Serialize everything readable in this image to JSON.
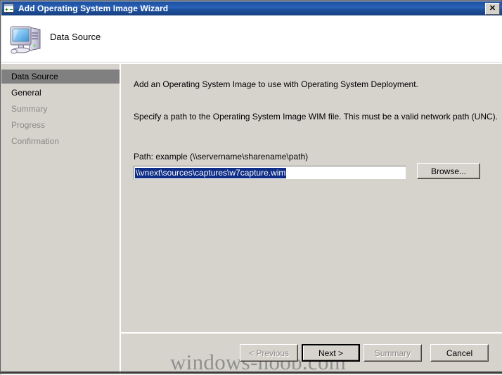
{
  "window": {
    "title": "Add Operating System Image Wizard",
    "icon": "wizard-window-icon",
    "close_label": "✕"
  },
  "header": {
    "icon": "computer-icon",
    "page_title": "Data Source"
  },
  "nav": {
    "items": [
      {
        "label": "Data Source",
        "state": "selected"
      },
      {
        "label": "General",
        "state": "enabled"
      },
      {
        "label": "Summary",
        "state": "disabled"
      },
      {
        "label": "Progress",
        "state": "disabled"
      },
      {
        "label": "Confirmation",
        "state": "disabled"
      }
    ]
  },
  "body": {
    "intro_text": "Add an Operating System Image to use with Operating System Deployment.",
    "instruction_text": "Specify a path to the Operating System Image WIM file. This must be a valid network path (UNC).",
    "path_label": "Path: example (\\\\servername\\sharename\\path)",
    "path_value": "\\\\vnext\\sources\\captures\\w7capture.wim",
    "path_placeholder": "\\\\servername\\sharename\\path",
    "browse_label": "Browse..."
  },
  "footer": {
    "previous_label": "< Previous",
    "next_label": "Next >",
    "summary_label": "Summary",
    "cancel_label": "Cancel"
  },
  "watermark": {
    "text": "windows-noob.com"
  },
  "colors": {
    "titlebar_start": "#1d4f9e",
    "titlebar_end": "#173f80",
    "dialog_face": "#d6d3cd",
    "selection_blue": "#0e2d86",
    "nav_selected": "#808080",
    "disabled_text": "#8d8a85",
    "watermark": "#8f8f8f"
  }
}
